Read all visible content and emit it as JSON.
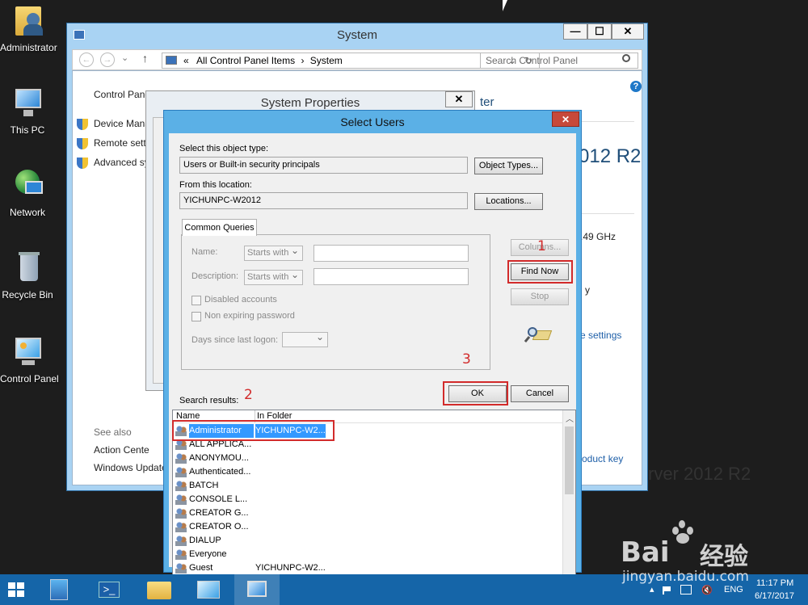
{
  "desktop": {
    "icons": [
      {
        "label": "Administrator"
      },
      {
        "label": "This PC"
      },
      {
        "label": "Network"
      },
      {
        "label": "Recycle Bin"
      },
      {
        "label": "Control Panel"
      }
    ]
  },
  "system_window": {
    "title": "System",
    "controls": {
      "minimize": "—",
      "maximize": "☐",
      "close": "✕"
    },
    "address": {
      "prefix": "«",
      "path1": "All Control Panel Items",
      "sep": "›",
      "path2": "System"
    },
    "search_placeholder": "Search Control Panel",
    "help": "?",
    "left_links": {
      "home": "Control Panel",
      "device": "Device Mana",
      "remote": "Remote setti",
      "advanced": "Advanced sy"
    },
    "see_also": {
      "heading": "See also",
      "action_center": "Action Cente",
      "windows_update": "Windows Update"
    },
    "right_fragments": {
      "ter": "ter",
      "r2": "012 R2",
      "ghz": ".49 GHz",
      "y": "y",
      "settings": "e settings",
      "product_key": "oduct key",
      "server": "rver 2012 R2"
    }
  },
  "props_window": {
    "title": "System Properties",
    "close": "✕"
  },
  "select_users": {
    "title": "Select Users",
    "close": "✕",
    "object_type_label": "Select this object type:",
    "object_type_value": "Users or Built-in security principals",
    "object_types_button": "Object Types...",
    "location_label": "From this location:",
    "location_value": "YICHUNPC-W2012",
    "locations_button": "Locations...",
    "tab": "Common Queries",
    "name_label": "Name:",
    "name_mode": "Starts with",
    "description_label": "Description:",
    "description_mode": "Starts with",
    "disabled_accounts": "Disabled accounts",
    "non_expiring": "Non expiring password",
    "days_label": "Days since last logon:",
    "columns_button": "Columns...",
    "find_now_button": "Find Now",
    "stop_button": "Stop",
    "ok_button": "OK",
    "cancel_button": "Cancel",
    "results_label": "Search results:",
    "col_name": "Name",
    "col_folder": "In Folder",
    "rows": [
      {
        "name": "Administrator",
        "folder": "YICHUNPC-W2..."
      },
      {
        "name": "ALL APPLICA...",
        "folder": ""
      },
      {
        "name": "ANONYMOU...",
        "folder": ""
      },
      {
        "name": "Authenticated...",
        "folder": ""
      },
      {
        "name": "BATCH",
        "folder": ""
      },
      {
        "name": "CONSOLE L...",
        "folder": ""
      },
      {
        "name": "CREATOR G...",
        "folder": ""
      },
      {
        "name": "CREATOR O...",
        "folder": ""
      },
      {
        "name": "DIALUP",
        "folder": ""
      },
      {
        "name": "Everyone",
        "folder": ""
      },
      {
        "name": "Guest",
        "folder": "YICHUNPC-W2..."
      }
    ],
    "annotations": {
      "one": "1",
      "two": "2",
      "three": "3"
    }
  },
  "taskbar": {
    "language": "ENG",
    "time": "11:17 PM",
    "date": "6/17/2017"
  },
  "watermark": {
    "brand": "Bai",
    "brand2": "经验",
    "url": "jingyan.baidu.com"
  }
}
